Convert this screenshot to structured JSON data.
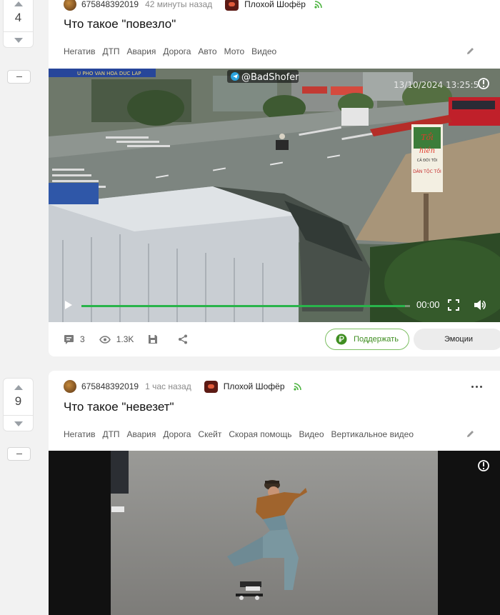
{
  "posts": [
    {
      "rating": "4",
      "author": "675848392019",
      "time": "42 минуты назад",
      "community": "Плохой Шофёр",
      "title": "Что такое \"повезло\"",
      "tags": [
        "Негатив",
        "ДТП",
        "Авария",
        "Дорога",
        "Авто",
        "Мото",
        "Видео"
      ],
      "video": {
        "watermark": "@BadShofer",
        "timestamp": "13/10/2024 13:25:5",
        "sign_text": [
          "Tổi",
          "hiền",
          "CẢ ĐỜI TÔI",
          "DÂN TỘC TỐI"
        ],
        "shop_text": "U PHO VAN HOA DUC LAP",
        "current_time": "00:00",
        "progress": 0.985
      },
      "footer": {
        "comments": "3",
        "views": "1.3K",
        "support_label": "Поддержать",
        "emotions_label": "Эмоции"
      }
    },
    {
      "rating": "9",
      "author": "675848392019",
      "time": "1 час назад",
      "community": "Плохой Шофёр",
      "title": "Что такое \"невезет\"",
      "tags": [
        "Негатив",
        "ДТП",
        "Авария",
        "Дорога",
        "Скейт",
        "Скорая помощь",
        "Видео",
        "Вертикальное видео"
      ]
    }
  ],
  "icons": {
    "vote_up": "triangle-up-icon",
    "vote_down": "triangle-down-icon",
    "collapse": "minus-icon",
    "rss": "rss-icon",
    "more": "more-dots-icon",
    "edit": "pencil-icon",
    "comments": "comment-icon",
    "views": "eye-icon",
    "save": "save-icon",
    "share": "share-icon",
    "ruble": "ruble-icon",
    "play": "play-icon",
    "fullscreen": "fullscreen-icon",
    "volume": "volume-icon",
    "info": "info-icon",
    "telegram": "telegram-icon"
  },
  "colors": {
    "accent_green": "#29b44b",
    "support_border": "#7cbf62",
    "support_text": "#3f8e21",
    "rss": "#4bb33f"
  }
}
